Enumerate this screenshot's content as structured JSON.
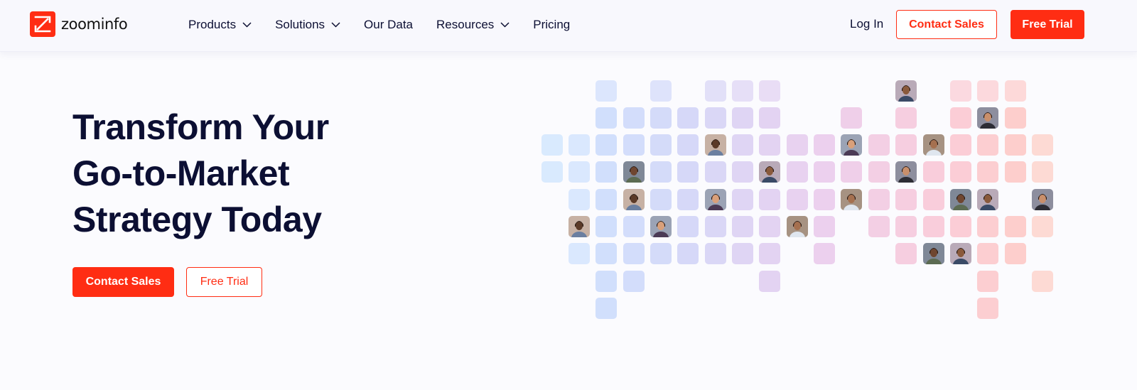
{
  "brand": {
    "name": "zoominfo",
    "accent_color": "#ff2d13",
    "text_color": "#0c0f33"
  },
  "nav": {
    "items": [
      {
        "label": "Products",
        "has_dropdown": true
      },
      {
        "label": "Solutions",
        "has_dropdown": true
      },
      {
        "label": "Our Data",
        "has_dropdown": false
      },
      {
        "label": "Resources",
        "has_dropdown": true
      },
      {
        "label": "Pricing",
        "has_dropdown": false
      }
    ],
    "login_label": "Log In",
    "contact_sales_label": "Contact Sales",
    "free_trial_label": "Free Trial"
  },
  "hero": {
    "title_lines": [
      "Transform Your",
      "Go-to-Market",
      "Strategy Today"
    ],
    "primary_cta": "Contact Sales",
    "secondary_cta": "Free Trial"
  },
  "mosaic": {
    "gradient_colors": [
      "#cfe6ff",
      "#d9d3f7",
      "#ecd0ee",
      "#fbd3dc",
      "#ffd2c9"
    ],
    "photo_icon": "person-avatar-icon"
  }
}
